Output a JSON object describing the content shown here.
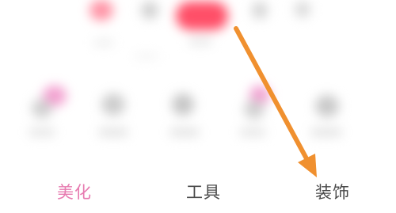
{
  "tabs": [
    {
      "label": "美化",
      "active": true
    },
    {
      "label": "工具",
      "active": false
    },
    {
      "label": "装饰",
      "active": false
    }
  ],
  "colors": {
    "active_tab": "#e77bb0",
    "inactive_tab": "#4a4a4a",
    "arrow": "#f0902f",
    "accent_blob": "#ff5a70"
  },
  "icons": [
    "blurred-icon-row-top",
    "blurred-icon-row-middle",
    "annotation-arrow-icon"
  ]
}
